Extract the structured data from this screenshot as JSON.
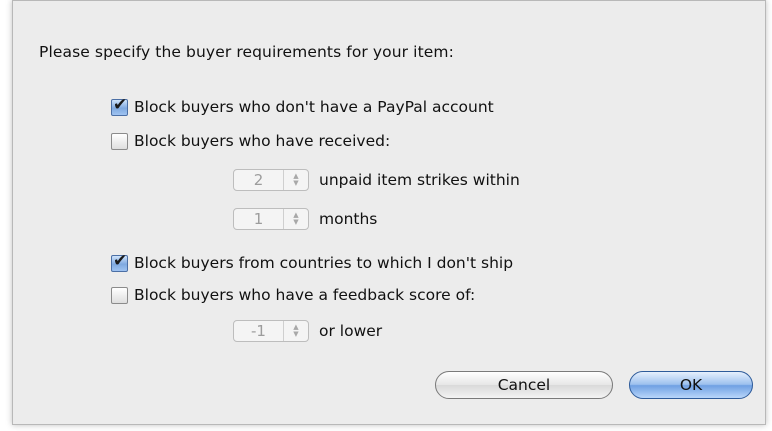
{
  "dialog": {
    "prompt": "Please specify the buyer requirements for your item:",
    "options": [
      {
        "label": "Block buyers who don't have a PayPal account",
        "checked": true
      },
      {
        "label": "Block buyers who have received:",
        "checked": false
      },
      {
        "label": "Block buyers from countries to which I don't ship",
        "checked": true
      },
      {
        "label": "Block buyers who have a feedback score of:",
        "checked": false
      }
    ],
    "strikes": {
      "value": "2",
      "suffix": "unpaid item strikes within"
    },
    "months": {
      "value": "1",
      "suffix": "months"
    },
    "feedback": {
      "value": "-1",
      "suffix": "or lower"
    },
    "buttons": {
      "cancel": "Cancel",
      "ok": "OK"
    }
  },
  "icons": {
    "check": "✔",
    "stepper_up": "▲",
    "stepper_down": "▼"
  },
  "colors": {
    "dialog_bg": "#ececec",
    "checkbox_checked": "#7fa9e0",
    "ok_button": "#6fa0e3"
  }
}
